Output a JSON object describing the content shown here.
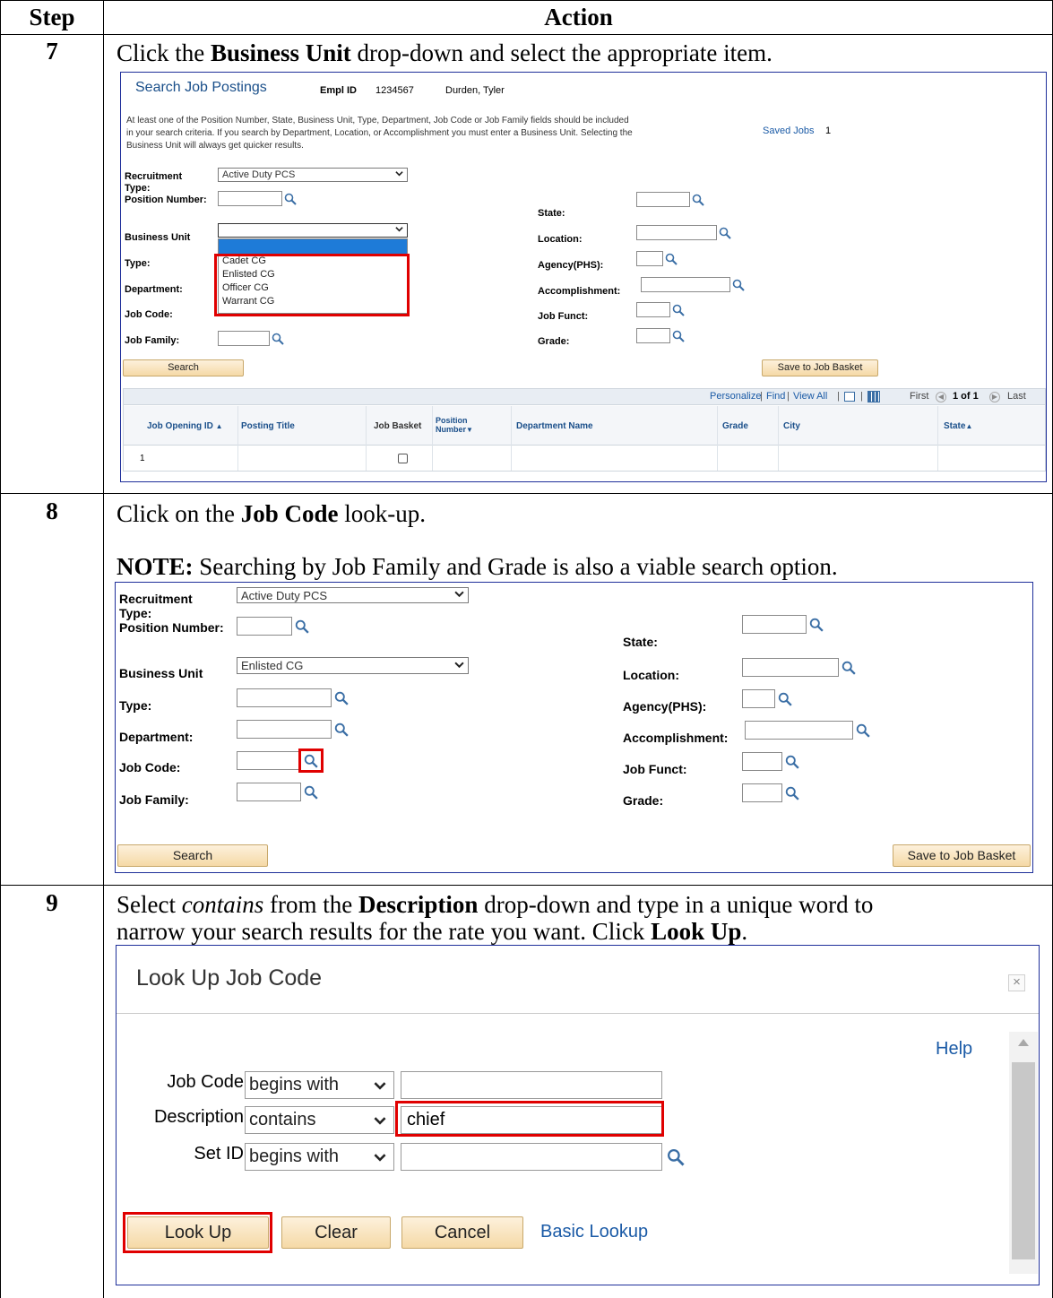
{
  "table": {
    "header_step": "Step",
    "header_action": "Action"
  },
  "step7": {
    "number": "7",
    "instr_pre": "Click the ",
    "instr_bold": "Business Unit",
    "instr_post": " drop-down and select the appropriate item.",
    "screen": {
      "title": "Search Job Postings",
      "empl_id_label": "Empl ID",
      "empl_id": "1234567",
      "name": "Durden, Tyler",
      "info_line1": "At least one of the Position Number, State, Business Unit, Type, Department, Job Code or Job Family fields should be included",
      "info_line2": "in your search criteria. If you search by Department, Location, or Accomplishment you must enter a Business Unit. Selecting the",
      "info_line3": "Business Unit will always get quicker results.",
      "saved_jobs_label": "Saved Jobs",
      "saved_jobs_count": "1",
      "recruitment_type_label_1": "Recruitment",
      "recruitment_type_label_2": "Type:",
      "recruitment_type_value": "Active Duty PCS",
      "position_number_label": "Position Number:",
      "business_unit_label": "Business Unit",
      "type_label": "Type:",
      "department_label": "Department:",
      "job_code_label": "Job Code:",
      "job_family_label": "Job Family:",
      "state_label": "State:",
      "location_label": "Location:",
      "agency_label": "Agency(PHS):",
      "accomplishment_label": "Accomplishment:",
      "job_funct_label": "Job Funct:",
      "grade_label": "Grade:",
      "dropdown_options": [
        "Cadet CG",
        "Enlisted CG",
        "Officer CG",
        "Warrant CG"
      ],
      "search_button": "Search",
      "save_basket_button": "Save to Job Basket",
      "grid_nav": {
        "personalize": "Personalize",
        "find": "Find",
        "view_all": "View All",
        "first": "First",
        "page": "1 of 1",
        "last": "Last"
      },
      "columns": {
        "job_opening_id": "Job Opening ID",
        "posting_title": "Posting Title",
        "job_basket": "Job Basket",
        "position_number_1": "Position",
        "position_number_2": "Number",
        "department_name": "Department Name",
        "grade": "Grade",
        "city": "City",
        "state": "State"
      },
      "row_number": "1"
    }
  },
  "step8": {
    "number": "8",
    "instr_pre": "Click on the ",
    "instr_bold": "Job Code",
    "instr_post": " look-up.",
    "note_bold": "NOTE:",
    "note_text": " Searching by Job Family and Grade is also a viable search option.",
    "screen": {
      "recruitment_type_label_1": "Recruitment",
      "recruitment_type_label_2": "Type:",
      "recruitment_type_value": "Active Duty PCS",
      "position_number_label": "Position Number:",
      "business_unit_label": "Business Unit",
      "business_unit_value": "Enlisted CG",
      "type_label": "Type:",
      "department_label": "Department:",
      "job_code_label": "Job Code:",
      "job_family_label": "Job Family:",
      "state_label": "State:",
      "location_label": "Location:",
      "agency_label": "Agency(PHS):",
      "accomplishment_label": "Accomplishment:",
      "job_funct_label": "Job Funct:",
      "grade_label": "Grade:",
      "search_button": "Search",
      "save_basket_button": "Save to Job Basket"
    }
  },
  "step9": {
    "number": "9",
    "line1_pre": "Select ",
    "line1_italic": "contains",
    "line1_mid": " from the ",
    "line1_bold": "Description",
    "line1_post": " drop-down and type in a unique word to",
    "line2_pre": "narrow your search results for the rate you want. Click ",
    "line2_bold": "Look Up",
    "line2_post": ".",
    "screen": {
      "title": "Look Up Job Code",
      "help": "Help",
      "job_code_label": "Job Code",
      "job_code_operator": "begins with",
      "description_label": "Description",
      "description_operator": "contains",
      "description_value": "chief",
      "set_id_label": "Set ID",
      "set_id_operator": "begins with",
      "lookup_button": "Look Up",
      "clear_button": "Clear",
      "cancel_button": "Cancel",
      "basic_lookup": "Basic Lookup"
    }
  },
  "colors": {
    "red_highlight": "#e00000",
    "link_blue": "#1a5aa6",
    "frame_blue": "#1f2f9a"
  }
}
